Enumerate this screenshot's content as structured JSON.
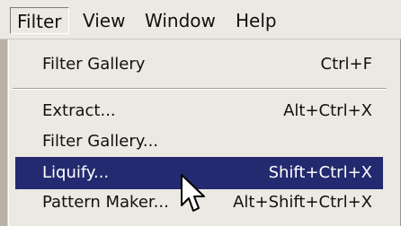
{
  "menubar": {
    "items": [
      {
        "label": "Filter",
        "active": true
      },
      {
        "label": "View",
        "active": false
      },
      {
        "label": "Window",
        "active": false
      },
      {
        "label": "Help",
        "active": false
      }
    ]
  },
  "menu": {
    "items": [
      {
        "label": "Filter Gallery",
        "shortcut": "Ctrl+F",
        "highlighted": false
      },
      {
        "label": "Extract...",
        "shortcut": "Alt+Ctrl+X",
        "highlighted": false
      },
      {
        "label": "Filter Gallery...",
        "shortcut": "",
        "highlighted": false
      },
      {
        "label": "Liquify...",
        "shortcut": "Shift+Ctrl+X",
        "highlighted": true
      },
      {
        "label": "Pattern Maker...",
        "shortcut": "Alt+Shift+Ctrl+X",
        "highlighted": false
      }
    ]
  },
  "colors": {
    "highlight_bg": "#242a6f",
    "highlight_text": "#ffffff",
    "menu_bg": "#ece9e2"
  },
  "icons": {
    "cursor": "arrow-cursor-icon"
  }
}
